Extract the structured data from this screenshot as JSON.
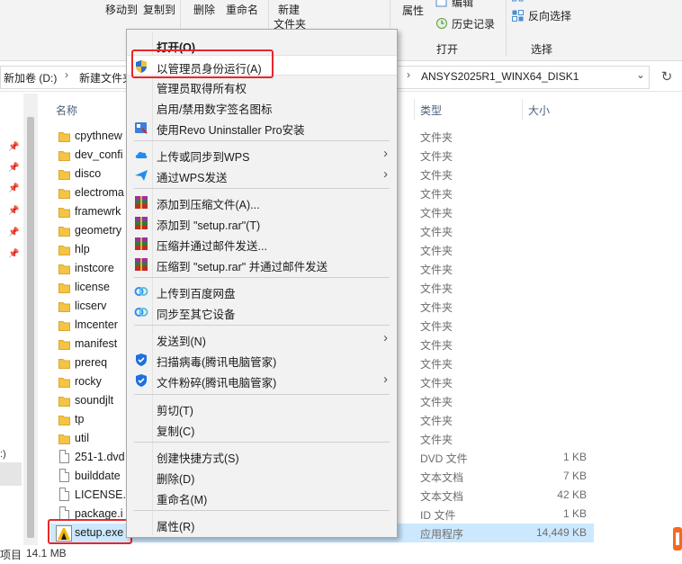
{
  "ribbon": {
    "move_to": "移动到",
    "copy_to": "复制到",
    "delete": "删除",
    "rename": "重命名",
    "new_folder_line1": "新建",
    "new_folder_line2": "文件夹",
    "properties": "属性",
    "edit": "编辑",
    "history": "历史记录",
    "open_group": "打开",
    "reverse_select": "反向选择",
    "select_group": "选择"
  },
  "address": {
    "crumb1": "新加卷 (D:)",
    "crumb2": "新建文件夹",
    "crumb3": "ANSYS2025R1_WINX64_DISK1"
  },
  "columns": {
    "name": "名称",
    "type": "类型",
    "size": "大小"
  },
  "files": [
    {
      "name": "cpythnew",
      "type": "文件夹",
      "size": "",
      "kind": "folder"
    },
    {
      "name": "dev_confi",
      "type": "文件夹",
      "size": "",
      "kind": "folder"
    },
    {
      "name": "disco",
      "type": "文件夹",
      "size": "",
      "kind": "folder"
    },
    {
      "name": "electroma",
      "type": "文件夹",
      "size": "",
      "kind": "folder"
    },
    {
      "name": "framewrk",
      "type": "文件夹",
      "size": "",
      "kind": "folder"
    },
    {
      "name": "geometry",
      "type": "文件夹",
      "size": "",
      "kind": "folder"
    },
    {
      "name": "hlp",
      "type": "文件夹",
      "size": "",
      "kind": "folder"
    },
    {
      "name": "instcore",
      "type": "文件夹",
      "size": "",
      "kind": "folder"
    },
    {
      "name": "license",
      "type": "文件夹",
      "size": "",
      "kind": "folder"
    },
    {
      "name": "licserv",
      "type": "文件夹",
      "size": "",
      "kind": "folder"
    },
    {
      "name": "lmcenter",
      "type": "文件夹",
      "size": "",
      "kind": "folder"
    },
    {
      "name": "manifest",
      "type": "文件夹",
      "size": "",
      "kind": "folder"
    },
    {
      "name": "prereq",
      "type": "文件夹",
      "size": "",
      "kind": "folder"
    },
    {
      "name": "rocky",
      "type": "文件夹",
      "size": "",
      "kind": "folder"
    },
    {
      "name": "soundjlt",
      "type": "文件夹",
      "size": "",
      "kind": "folder"
    },
    {
      "name": "tp",
      "type": "文件夹",
      "size": "",
      "kind": "folder"
    },
    {
      "name": "util",
      "type": "文件夹",
      "size": "",
      "kind": "folder"
    },
    {
      "name": "251-1.dvd",
      "type": "DVD 文件",
      "size": "1 KB",
      "kind": "doc"
    },
    {
      "name": "builddate",
      "type": "文本文档",
      "size": "7 KB",
      "kind": "doc"
    },
    {
      "name": "LICENSE.T",
      "type": "文本文档",
      "size": "42 KB",
      "kind": "doc"
    },
    {
      "name": "package.i",
      "type": "ID 文件",
      "size": "1 KB",
      "kind": "doc"
    },
    {
      "name": "setup.exe",
      "type": "应用程序",
      "size": "14,449 KB",
      "kind": "exe"
    }
  ],
  "status": {
    "items_frag": "项目",
    "size": "14.1 MB",
    "left_frag": ":)"
  },
  "menu": {
    "open": "打开(O)",
    "run_as_admin": "以管理员身份运行(A)",
    "take_ownership": "管理员取得所有权",
    "toggle_signature": "启用/禁用数字签名图标",
    "revo": "使用Revo Uninstaller Pro安装",
    "wps_upload": "上传或同步到WPS",
    "wps_send": "通过WPS发送",
    "add_archive": "添加到压缩文件(A)...",
    "add_setup_rar": "添加到 \"setup.rar\"(T)",
    "compress_email": "压缩并通过邮件发送...",
    "compress_setup_email": "压缩到 \"setup.rar\" 并通过邮件发送",
    "baidu_upload": "上传到百度网盘",
    "baidu_sync": "同步至其它设备",
    "send_to": "发送到(N)",
    "scan_virus": "扫描病毒(腾讯电脑管家)",
    "shred": "文件粉碎(腾讯电脑管家)",
    "cut": "剪切(T)",
    "copy": "复制(C)",
    "create_shortcut": "创建快捷方式(S)",
    "delete": "删除(D)",
    "rename": "重命名(M)",
    "properties": "属性(R)"
  },
  "colors": {
    "selection": "#cce8ff",
    "highlight_box": "#e8272b",
    "folder": "#f5c443",
    "menu_bg": "#f2f2f2"
  }
}
